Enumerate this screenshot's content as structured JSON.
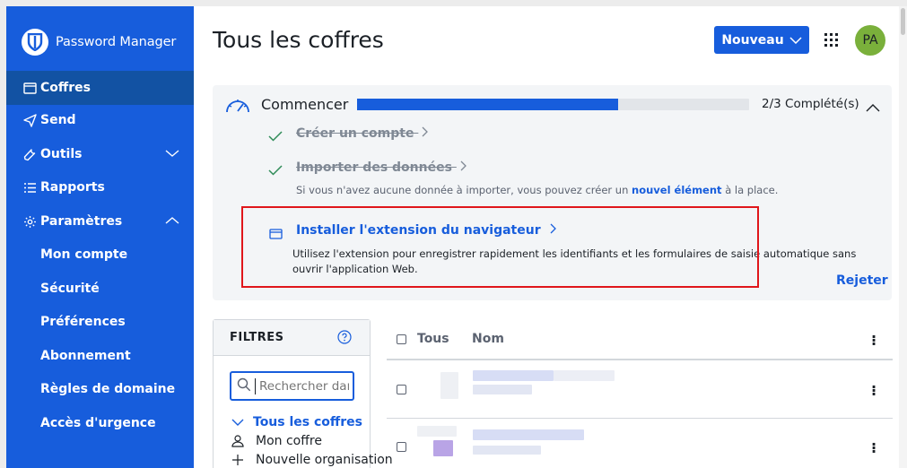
{
  "app": {
    "name": "Password Manager"
  },
  "sidebar": {
    "items": [
      {
        "label": "Coffres",
        "icon": "vault-icon",
        "active": true
      },
      {
        "label": "Send",
        "icon": "send-icon"
      },
      {
        "label": "Outils",
        "icon": "wrench-icon",
        "expandable": true
      },
      {
        "label": "Rapports",
        "icon": "list-icon"
      },
      {
        "label": "Paramètres",
        "icon": "gear-icon",
        "expanded": true
      }
    ],
    "settings_children": [
      "Mon compte",
      "Sécurité",
      "Préférences",
      "Abonnement",
      "Règles de domaine",
      "Accès d'urgence"
    ]
  },
  "header": {
    "title": "Tous les coffres",
    "new_button": "Nouveau",
    "avatar_initials": "PA",
    "avatar_color": "#7ab03b"
  },
  "onboarding": {
    "title": "Commencer",
    "progress_fraction": 0.667,
    "progress_label": "2/3 Complété(s)",
    "tasks": {
      "create_account": "Créer un compte",
      "import_data": "Importer des données",
      "import_hint_before": "Si vous n'avez aucune donnée à importer, vous pouvez créer un",
      "import_hint_link": "nouvel élément",
      "import_hint_after": "à la place.",
      "install_extension": "Installer l'extension du navigateur",
      "install_extension_desc": "Utilisez l'extension pour enregistrer rapidement les identifiants et les formulaires de saisie automatique sans ouvrir l'application Web."
    },
    "dismiss": "Rejeter"
  },
  "filters": {
    "title": "FILTRES",
    "search_placeholder": "Rechercher dans les coffres",
    "all_vaults": "Tous les coffres",
    "my_vault": "Mon coffre",
    "new_org": "Nouvelle organisation"
  },
  "list": {
    "col_all": "Tous",
    "col_name": "Nom"
  },
  "colors": {
    "brand": "#175ddc",
    "highlight": "#e0161b"
  }
}
